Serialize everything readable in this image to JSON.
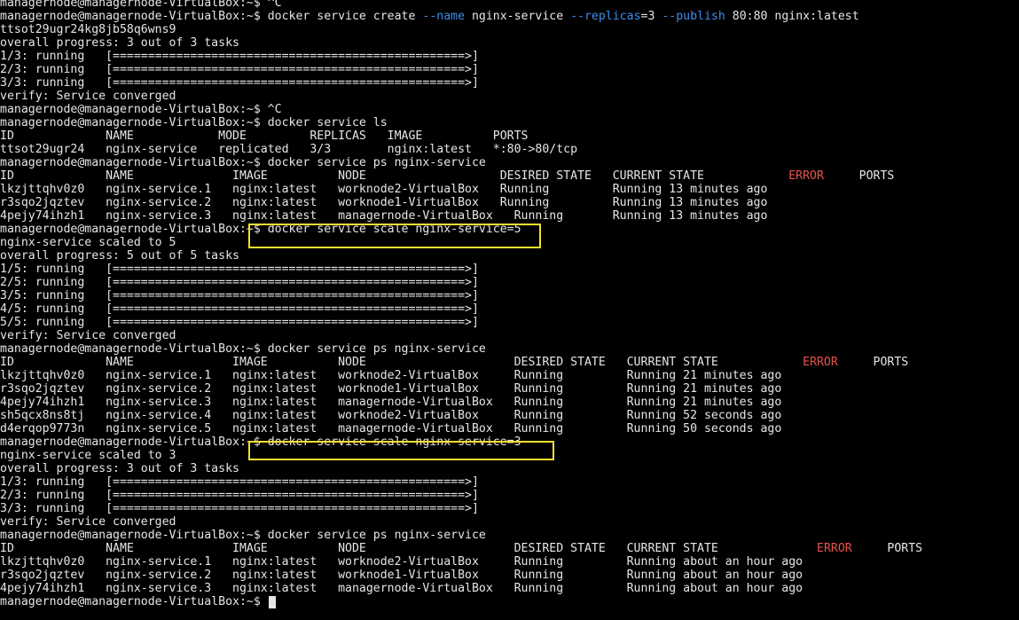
{
  "terminal": {
    "prompt": "managernode@managernode-VirtualBox:~$ ",
    "lines": [
      {
        "segs": [
          {
            "t": "managernode@managernode-VirtualBox:~$ ^C"
          }
        ]
      },
      {
        "segs": [
          {
            "t": "managernode@managernode-VirtualBox:~$ docker service create "
          },
          {
            "t": "--name",
            "c": "cmd-arg"
          },
          {
            "t": " nginx-service "
          },
          {
            "t": "--replicas",
            "c": "cmd-arg"
          },
          {
            "t": "=3 "
          },
          {
            "t": "--publish",
            "c": "cmd-arg"
          },
          {
            "t": " 80:80 nginx:latest"
          }
        ]
      },
      {
        "segs": [
          {
            "t": "ttsot29ugr24kg8jb58q6wns9"
          }
        ]
      },
      {
        "segs": [
          {
            "t": "overall progress: 3 out of 3 tasks"
          }
        ]
      },
      {
        "segs": [
          {
            "t": "1/3: running   [==================================================>]"
          }
        ]
      },
      {
        "segs": [
          {
            "t": "2/3: running   [==================================================>]"
          }
        ]
      },
      {
        "segs": [
          {
            "t": "3/3: running   [==================================================>]"
          }
        ]
      },
      {
        "segs": [
          {
            "t": "verify: Service converged"
          }
        ]
      },
      {
        "segs": [
          {
            "t": "managernode@managernode-VirtualBox:~$ ^C"
          }
        ]
      },
      {
        "segs": [
          {
            "t": "managernode@managernode-VirtualBox:~$ docker service ls"
          }
        ]
      },
      {
        "segs": [
          {
            "t": "ID             NAME            MODE         REPLICAS   IMAGE          PORTS"
          }
        ]
      },
      {
        "segs": [
          {
            "t": "ttsot29ugr24   nginx-service   replicated   3/3        nginx:latest   *:80->80/tcp"
          }
        ]
      },
      {
        "segs": [
          {
            "t": "managernode@managernode-VirtualBox:~$ docker service ps nginx-service"
          }
        ]
      },
      {
        "segs": [
          {
            "t": "ID             NAME              IMAGE          NODE                   DESIRED STATE   CURRENT STATE            "
          },
          {
            "t": "ERROR",
            "c": "err"
          },
          {
            "t": "     PORTS"
          }
        ]
      },
      {
        "segs": [
          {
            "t": "lkzjttqhv0z0   nginx-service.1   nginx:latest   worknode2-VirtualBox   Running         Running 13 minutes ago"
          }
        ]
      },
      {
        "segs": [
          {
            "t": "r3sqo2jqztev   nginx-service.2   nginx:latest   worknode1-VirtualBox   Running         Running 13 minutes ago"
          }
        ]
      },
      {
        "segs": [
          {
            "t": "4pejy74ihzh1   nginx-service.3   nginx:latest   managernode-VirtualBox   Running       Running 13 minutes ago"
          }
        ]
      },
      {
        "segs": [
          {
            "t": "managernode@managernode-VirtualBox:~$ docker service scale nginx-service=5"
          }
        ]
      },
      {
        "segs": [
          {
            "t": "nginx-service scaled to 5"
          }
        ]
      },
      {
        "segs": [
          {
            "t": "overall progress: 5 out of 5 tasks"
          }
        ]
      },
      {
        "segs": [
          {
            "t": "1/5: running   [==================================================>]"
          }
        ]
      },
      {
        "segs": [
          {
            "t": "2/5: running   [==================================================>]"
          }
        ]
      },
      {
        "segs": [
          {
            "t": "3/5: running   [==================================================>]"
          }
        ]
      },
      {
        "segs": [
          {
            "t": "4/5: running   [==================================================>]"
          }
        ]
      },
      {
        "segs": [
          {
            "t": "5/5: running   [==================================================>]"
          }
        ]
      },
      {
        "segs": [
          {
            "t": "verify: Service converged"
          }
        ]
      },
      {
        "segs": [
          {
            "t": "managernode@managernode-VirtualBox:~$ docker service ps nginx-service"
          }
        ]
      },
      {
        "segs": [
          {
            "t": "ID             NAME              IMAGE          NODE                     DESIRED STATE   CURRENT STATE            "
          },
          {
            "t": "ERROR",
            "c": "err"
          },
          {
            "t": "     PORTS"
          }
        ]
      },
      {
        "segs": [
          {
            "t": "lkzjttqhv0z0   nginx-service.1   nginx:latest   worknode2-VirtualBox     Running         Running 21 minutes ago"
          }
        ]
      },
      {
        "segs": [
          {
            "t": "r3sqo2jqztev   nginx-service.2   nginx:latest   worknode1-VirtualBox     Running         Running 21 minutes ago"
          }
        ]
      },
      {
        "segs": [
          {
            "t": "4pejy74ihzh1   nginx-service.3   nginx:latest   managernode-VirtualBox   Running         Running 21 minutes ago"
          }
        ]
      },
      {
        "segs": [
          {
            "t": "sh5qcx8ns8tj   nginx-service.4   nginx:latest   worknode2-VirtualBox     Running         Running 52 seconds ago"
          }
        ]
      },
      {
        "segs": [
          {
            "t": "d4erqop9773n   nginx-service.5   nginx:latest   managernode-VirtualBox   Running         Running 50 seconds ago"
          }
        ]
      },
      {
        "segs": [
          {
            "t": "managernode@managernode-VirtualBox:~$ docker service scale nginx-service=3"
          }
        ]
      },
      {
        "segs": [
          {
            "t": "nginx-service scaled to 3"
          }
        ]
      },
      {
        "segs": [
          {
            "t": "overall progress: 3 out of 3 tasks"
          }
        ]
      },
      {
        "segs": [
          {
            "t": "1/3: running   [==================================================>]"
          }
        ]
      },
      {
        "segs": [
          {
            "t": "2/3: running   [==================================================>]"
          }
        ]
      },
      {
        "segs": [
          {
            "t": "3/3: running   [==================================================>]"
          }
        ]
      },
      {
        "segs": [
          {
            "t": "verify: Service converged"
          }
        ]
      },
      {
        "segs": [
          {
            "t": "managernode@managernode-VirtualBox:~$ docker service ps nginx-service"
          }
        ]
      },
      {
        "segs": [
          {
            "t": "ID             NAME              IMAGE          NODE                     DESIRED STATE   CURRENT STATE              "
          },
          {
            "t": "ERROR",
            "c": "err"
          },
          {
            "t": "     PORTS"
          }
        ]
      },
      {
        "segs": [
          {
            "t": "lkzjttqhv0z0   nginx-service.1   nginx:latest   worknode2-VirtualBox     Running         Running about an hour ago"
          }
        ]
      },
      {
        "segs": [
          {
            "t": "r3sqo2jqztev   nginx-service.2   nginx:latest   worknode1-VirtualBox     Running         Running about an hour ago"
          }
        ]
      },
      {
        "segs": [
          {
            "t": "4pejy74ihzh1   nginx-service.3   nginx:latest   managernode-VirtualBox   Running         Running about an hour ago"
          }
        ]
      },
      {
        "segs": [
          {
            "t": "managernode@managernode-VirtualBox:~$ "
          }
        ]
      }
    ]
  },
  "colors": {
    "background": "#000000",
    "foreground": "#e6e6e6",
    "option_flag": "#3b8eea",
    "error_header": "#e5534b",
    "highlight_box": "#f5e02b"
  }
}
